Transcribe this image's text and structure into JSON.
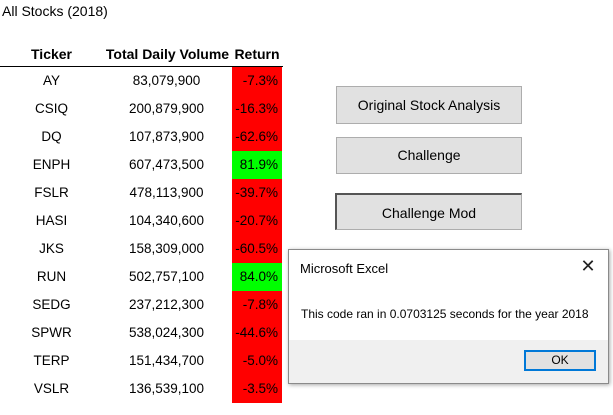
{
  "sheet": {
    "title": "All Stocks (2018)",
    "headers": {
      "ticker": "Ticker",
      "volume": "Total Daily Volume",
      "return": "Return"
    },
    "rows": [
      {
        "ticker": "AY",
        "volume": "83,079,900",
        "return": "-7.3%",
        "positive": false
      },
      {
        "ticker": "CSIQ",
        "volume": "200,879,900",
        "return": "-16.3%",
        "positive": false
      },
      {
        "ticker": "DQ",
        "volume": "107,873,900",
        "return": "-62.6%",
        "positive": false
      },
      {
        "ticker": "ENPH",
        "volume": "607,473,500",
        "return": "81.9%",
        "positive": true
      },
      {
        "ticker": "FSLR",
        "volume": "478,113,900",
        "return": "-39.7%",
        "positive": false
      },
      {
        "ticker": "HASI",
        "volume": "104,340,600",
        "return": "-20.7%",
        "positive": false
      },
      {
        "ticker": "JKS",
        "volume": "158,309,000",
        "return": "-60.5%",
        "positive": false
      },
      {
        "ticker": "RUN",
        "volume": "502,757,100",
        "return": "84.0%",
        "positive": true
      },
      {
        "ticker": "SEDG",
        "volume": "237,212,300",
        "return": "-7.8%",
        "positive": false
      },
      {
        "ticker": "SPWR",
        "volume": "538,024,300",
        "return": "-44.6%",
        "positive": false
      },
      {
        "ticker": "TERP",
        "volume": "151,434,700",
        "return": "-5.0%",
        "positive": false
      },
      {
        "ticker": "VSLR",
        "volume": "136,539,100",
        "return": "-3.5%",
        "positive": false
      }
    ]
  },
  "buttons": {
    "original": "Original Stock Analysis",
    "challenge": "Challenge",
    "challenge_mod": "Challenge Mod"
  },
  "dialog": {
    "title": "Microsoft Excel",
    "close_icon": "close-icon",
    "message": "This code ran in 0.0703125 seconds for the year 2018",
    "ok_label": "OK"
  },
  "colors": {
    "negative_fill": "#ff0000",
    "positive_fill": "#00ff00",
    "button_face": "#e1e1e1",
    "ok_border": "#0078d7"
  }
}
